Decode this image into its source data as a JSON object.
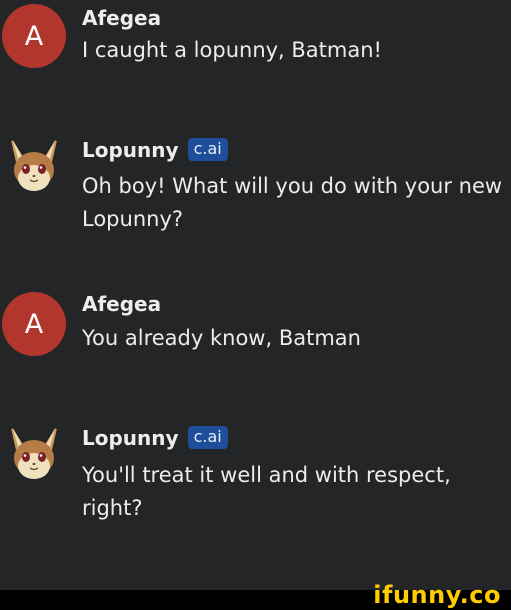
{
  "messages": [
    {
      "sender": "Afegea",
      "avatar_letter": "A",
      "avatar_type": "letter",
      "badge": "",
      "lines": [
        "I caught a lopunny, Batman!"
      ]
    },
    {
      "sender": "Lopunny",
      "avatar_type": "lopunny-icon",
      "badge": "c.ai",
      "lines": [
        "Oh boy! What will you do with your new",
        "Lopunny?"
      ]
    },
    {
      "sender": "Afegea",
      "avatar_letter": "A",
      "avatar_type": "letter",
      "badge": "",
      "lines": [
        "You already know, Batman"
      ]
    },
    {
      "sender": "Lopunny",
      "avatar_type": "lopunny-icon",
      "badge": "c.ai",
      "lines": [
        "You'll treat it well and with respect,",
        "right?"
      ]
    }
  ],
  "watermark": "ifunny.co",
  "colors": {
    "background": "#242527",
    "user_avatar": "#b2362e",
    "badge": "#1f4e9b",
    "watermark": "#ffcc00"
  }
}
